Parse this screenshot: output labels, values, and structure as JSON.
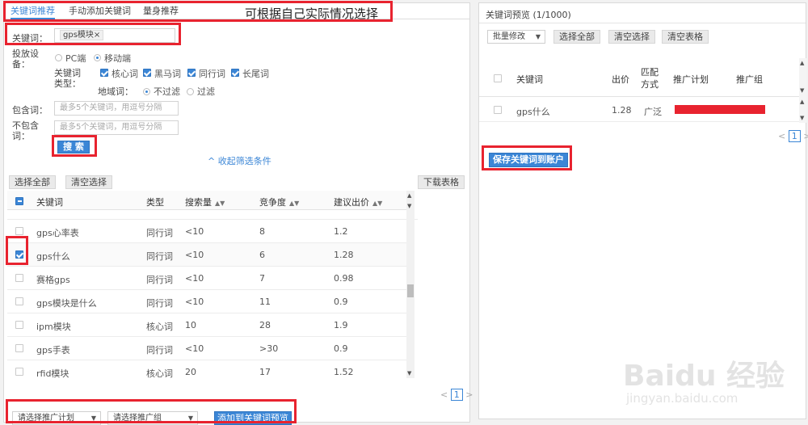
{
  "annotation": "可根据自己实际情况选择",
  "tabs": [
    "关键词推荐",
    "手动添加关键词",
    "量身推荐"
  ],
  "filters": {
    "keyword_label": "关键词：",
    "keyword_tag": "gps模块",
    "device_label": "投放设备：",
    "device_pc": "PC端",
    "device_mobile": "移动端",
    "kwtype_label": "关键词类型：",
    "kwtypes": [
      "核心词",
      "黑马词",
      "同行词",
      "长尾词"
    ],
    "region_label": "地域词：",
    "region_no": "不过滤",
    "region_yes": "过滤",
    "include_label": "包含词：",
    "include_placeholder": "最多5个关键词，用逗号分隔",
    "exclude_label": "不包含词：",
    "exclude_placeholder": "最多5个关键词，用逗号分隔",
    "search_button": "搜 索",
    "collapse_link": "收起筛选条件"
  },
  "list_toolbar": {
    "select_all": "选择全部",
    "clear": "清空选择",
    "download": "下载表格"
  },
  "table": {
    "headers": [
      "关键词",
      "类型",
      "搜索量",
      "竞争度",
      "建议出价"
    ],
    "rows": [
      {
        "kw": "gps心率表",
        "type": "同行词",
        "vol": "<10",
        "comp": "8",
        "bid": "1.2",
        "checked": false
      },
      {
        "kw": "gps什么",
        "type": "同行词",
        "vol": "<10",
        "comp": "6",
        "bid": "1.28",
        "checked": true
      },
      {
        "kw": "赛格gps",
        "type": "同行词",
        "vol": "<10",
        "comp": "7",
        "bid": "0.98",
        "checked": false
      },
      {
        "kw": "gps模块是什么",
        "type": "同行词",
        "vol": "<10",
        "comp": "11",
        "bid": "0.9",
        "checked": false
      },
      {
        "kw": "ipm模块",
        "type": "核心词",
        "vol": "10",
        "comp": "28",
        "bid": "1.9",
        "checked": false
      },
      {
        "kw": "gps手表",
        "type": "同行词",
        "vol": "<10",
        "comp": ">30",
        "bid": "0.9",
        "checked": false
      },
      {
        "kw": "rfid模块",
        "type": "核心词",
        "vol": "20",
        "comp": "17",
        "bid": "1.52",
        "checked": false
      }
    ]
  },
  "left_pager": "1",
  "bottom_bar": {
    "plan_select": "请选择推广计划",
    "group_select": "请选择推广组",
    "add_button": "添加到关键词预览"
  },
  "preview": {
    "title": "关键词预览 (1/1000)",
    "bulk_select": "批量修改",
    "select_all": "选择全部",
    "clear": "清空选择",
    "clear_table": "清空表格",
    "headers": [
      "关键词",
      "出价",
      "匹配方式",
      "推广计划",
      "推广组"
    ],
    "row": {
      "kw": "gps什么",
      "bid": "1.28",
      "match": "广泛"
    },
    "pager": "1",
    "save_button": "保存关键词到账户"
  },
  "watermark": {
    "brand": "Baidu 经验",
    "url": "jingyan.baidu.com"
  },
  "colors": {
    "accent": "#3b86d6",
    "highlight": "#e8232f"
  }
}
